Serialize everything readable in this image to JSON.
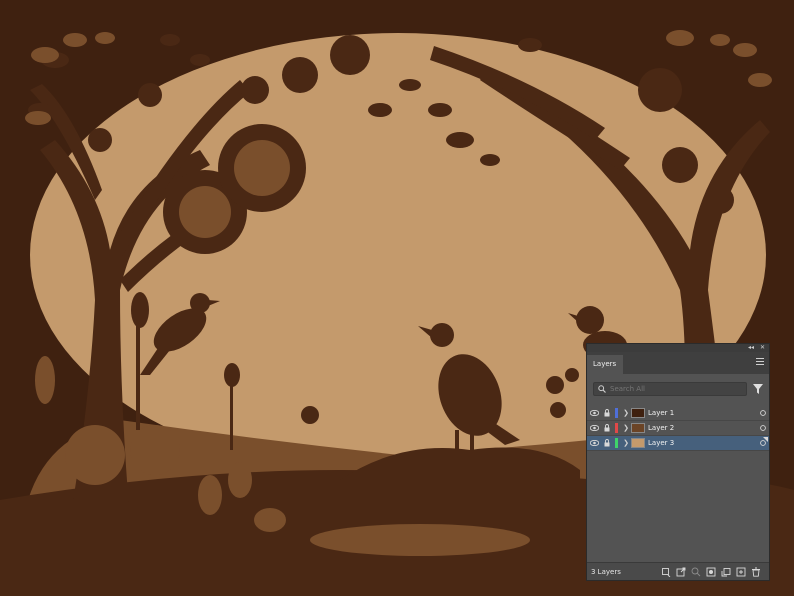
{
  "artwork": {
    "colors": {
      "background": "#3f2110",
      "sky": "#c49a6c",
      "midground": "#7a4f2c",
      "silhouette": "#4a2814"
    }
  },
  "layers_panel": {
    "title": "Layers",
    "menu_icon": "hamburger-menu-icon",
    "search_placeholder": "Search All",
    "filter_icon": "filter-icon",
    "layers": [
      {
        "name": "Layer 1",
        "color": "#4f6fd8",
        "selected": false
      },
      {
        "name": "Layer 2",
        "color": "#e04848",
        "selected": false
      },
      {
        "name": "Layer 3",
        "color": "#3fd36a",
        "selected": true
      }
    ],
    "footer": {
      "count_label": "3 Layers"
    }
  }
}
